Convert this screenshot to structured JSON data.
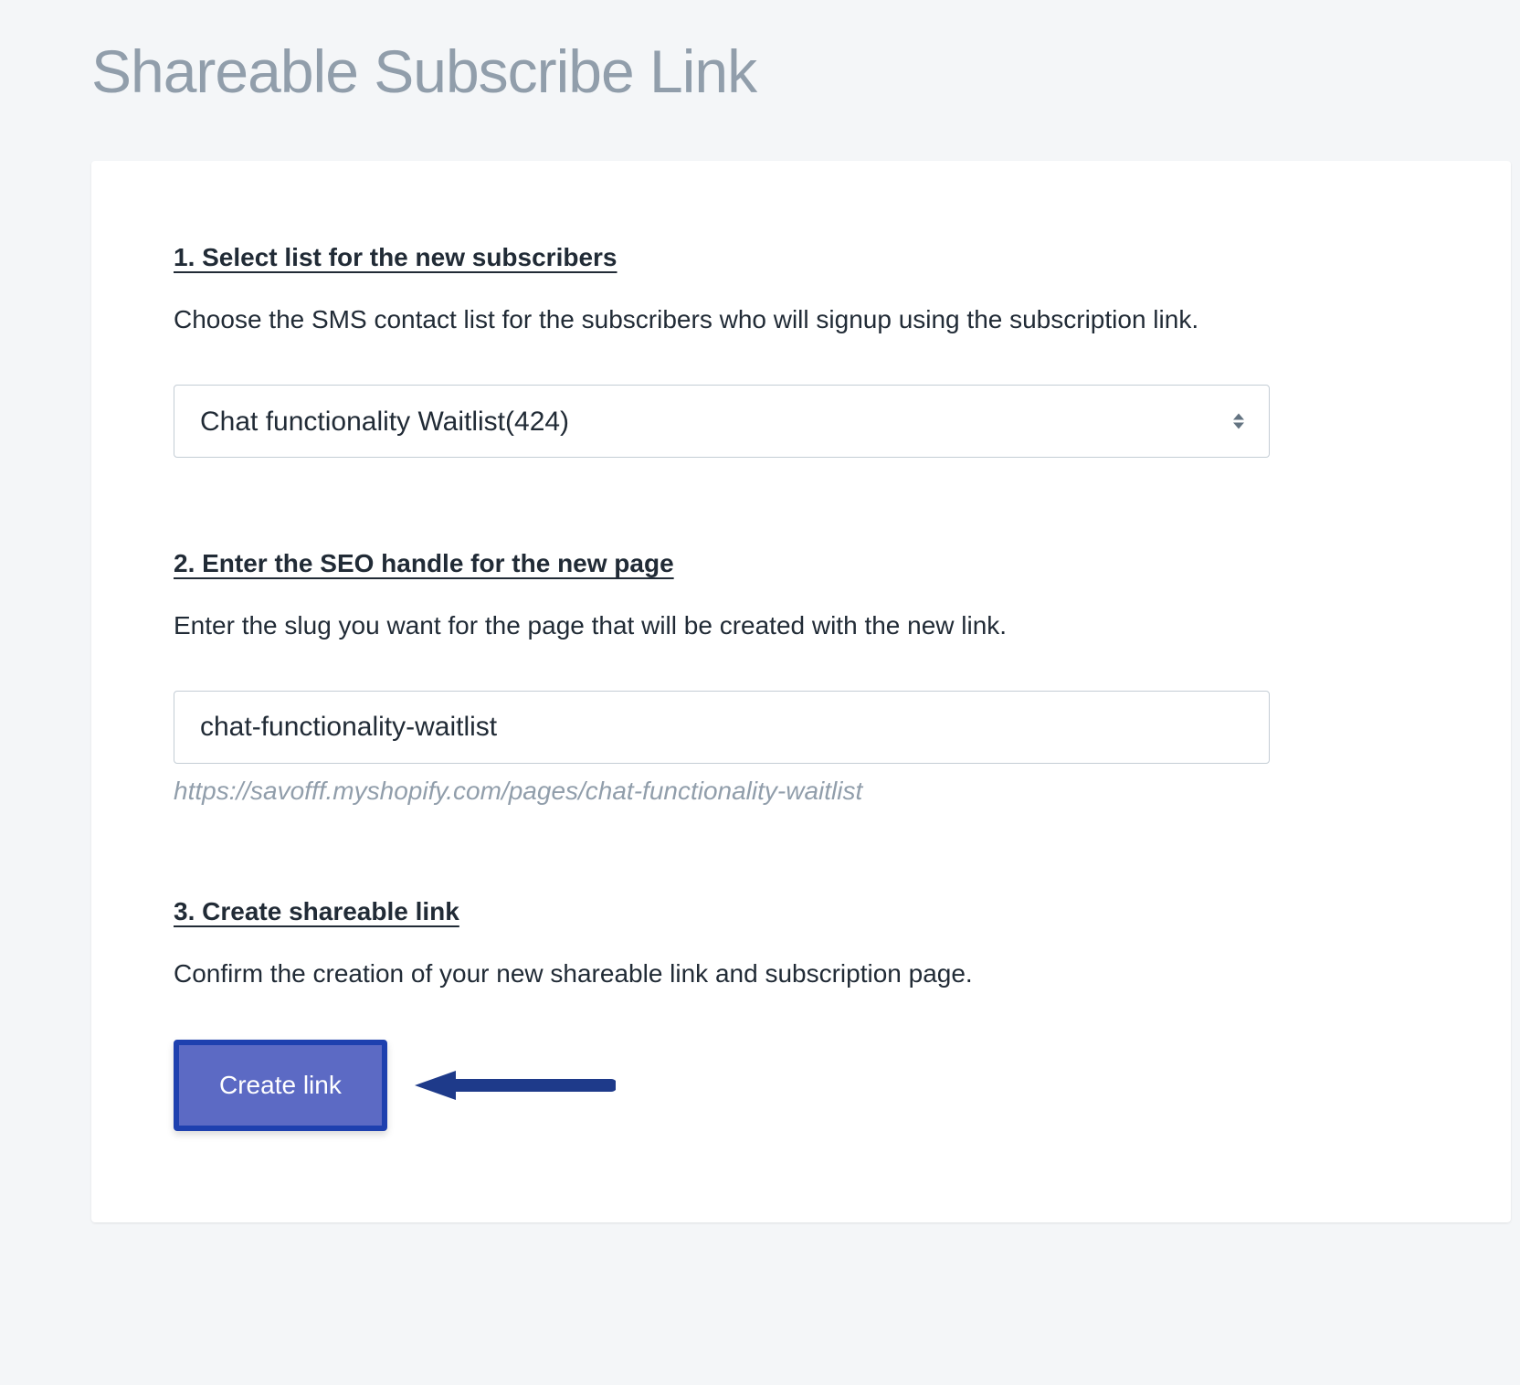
{
  "page": {
    "title": "Shareable Subscribe Link"
  },
  "section1": {
    "heading": "1. Select list for the new subscribers",
    "description": "Choose the SMS contact list for the subscribers who will signup using the subscription link.",
    "select": {
      "value": "Chat functionality Waitlist(424)"
    }
  },
  "section2": {
    "heading": "2. Enter the SEO handle for the new page",
    "description": "Enter the slug you want for the page that will be created with the new link.",
    "input": {
      "value": "chat-functionality-waitlist"
    },
    "url_preview": "https://savofff.myshopify.com/pages/chat-functionality-waitlist"
  },
  "section3": {
    "heading": "3. Create shareable link",
    "description": "Confirm the creation of your new shareable link and subscription page.",
    "button_label": "Create link"
  }
}
